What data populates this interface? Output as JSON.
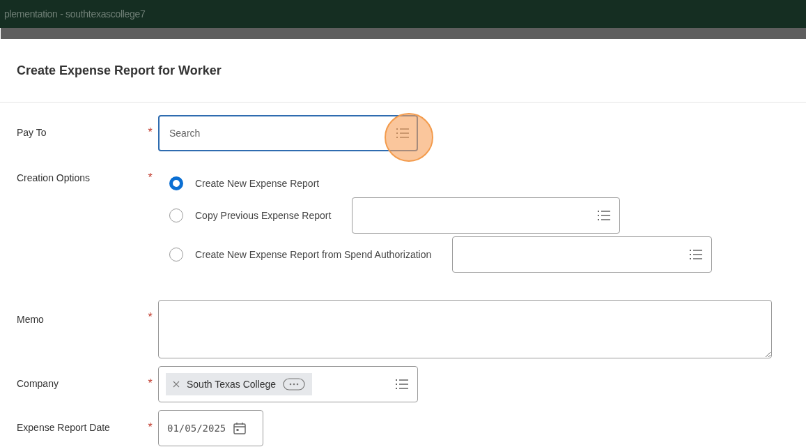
{
  "top_bar": {
    "title": "plementation - southtexascollege7"
  },
  "page": {
    "title": "Create Expense Report for Worker"
  },
  "pay_to": {
    "label": "Pay To",
    "required_mark": "*",
    "placeholder": "Search",
    "focused": true
  },
  "creation_options": {
    "label": "Creation Options",
    "required_mark": "*",
    "options": [
      {
        "label": "Create New Expense Report",
        "selected": true,
        "kind": "plain"
      },
      {
        "label": "Copy Previous Expense Report",
        "selected": false,
        "kind": "prompt"
      },
      {
        "label": "Create New Expense Report from Spend Authorization",
        "selected": false,
        "kind": "prompt"
      }
    ]
  },
  "memo": {
    "label": "Memo",
    "required_mark": "*"
  },
  "company": {
    "label": "Company",
    "required_mark": "*",
    "chips": [
      "South Texas College"
    ]
  },
  "expense_report_date": {
    "label": "Expense Report Date",
    "required_mark": "*",
    "value": "01/05/2025"
  }
}
